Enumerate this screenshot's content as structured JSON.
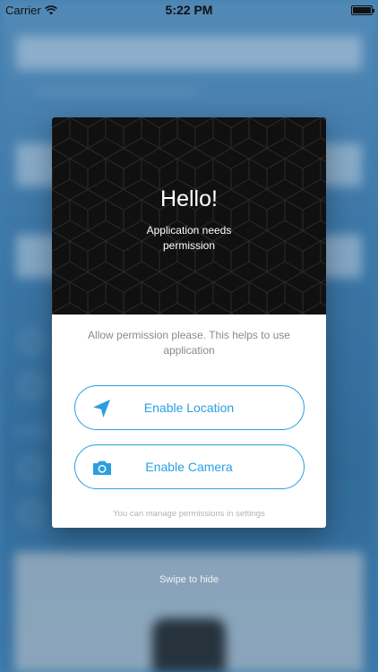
{
  "status_bar": {
    "carrier": "Carrier",
    "time": "5:22 PM",
    "battery_level": 1.0
  },
  "dialog": {
    "title": "Hello!",
    "subtitle": "Application needs permission",
    "description": "Allow permission please. This helps to use application",
    "buttons": [
      {
        "label": "Enable Location",
        "icon": "location-arrow-icon"
      },
      {
        "label": "Enable Camera",
        "icon": "camera-icon"
      }
    ],
    "footer": "You can manage permissions in settings"
  },
  "swipe_hint": "Swipe to hide",
  "colors": {
    "accent": "#2a9fe0",
    "header_bg": "#101010",
    "muted_text": "#8a8a8a"
  }
}
